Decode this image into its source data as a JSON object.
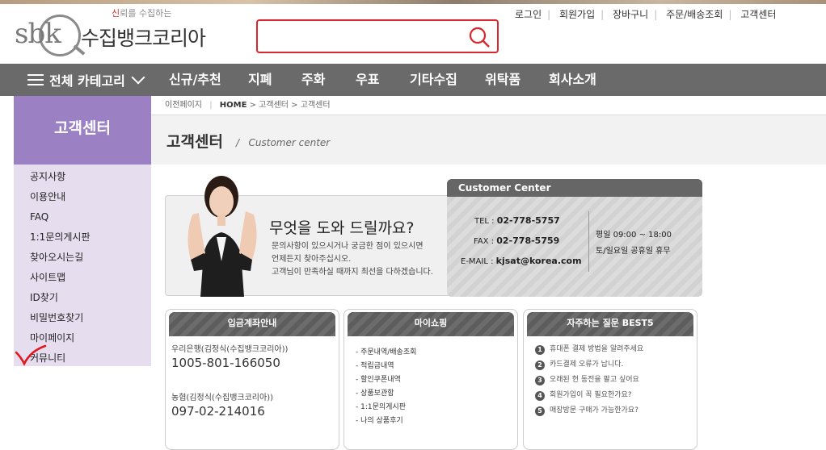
{
  "logo": {
    "sbk": "sbk",
    "slogan_red": "신",
    "slogan_rest": "뢰를 수집하는",
    "name": "수집뱅크코리아"
  },
  "search": {
    "placeholder": ""
  },
  "toplinks": [
    "로그인",
    "회원가입",
    "장바구니",
    "주문/배송조회",
    "고객센터"
  ],
  "nav": {
    "all_label": "전체 카테고리",
    "items": [
      "신규/추천",
      "지폐",
      "주화",
      "우표",
      "기타수집",
      "위탁품",
      "회사소개"
    ]
  },
  "sidebar": {
    "title": "고객센터",
    "items": [
      "공지사항",
      "이용안내",
      "FAQ",
      "1:1문의게시판",
      "찾아오시는길",
      "사이트맵",
      "ID찾기",
      "비밀번호찾기",
      "마이페이지",
      "커뮤니티"
    ]
  },
  "breadcrumb": {
    "prev": "이전페이지",
    "home": "HOME",
    "sep": ">",
    "level1": "고객센터",
    "level2": "고객센터"
  },
  "title": {
    "main": "고객센터",
    "slash": "/",
    "sub": "Customer center"
  },
  "banner": {
    "heading": "무엇을 도와 드릴까요?",
    "line1": "문의사항이 있으시거나 궁금한 점이 있으시면",
    "line2": "언제든지 찾아주십시오.",
    "line3": "고객님이 만족하실 때까지 최선을 다하겠습니다."
  },
  "customer_center": {
    "title": "Customer Center",
    "tel_label": "TEL :",
    "tel": "02-778-5757",
    "fax_label": "FAX :",
    "fax": "02-778-5759",
    "email_label": "E-MAIL :",
    "email": "kjsat@korea.com",
    "hours": "평일 09:00 ~ 18:00",
    "closed": "토/일요일 공휴일 휴무"
  },
  "deposit": {
    "title": "입금계좌안내",
    "bank1_label": "우리은행(김정식(수집뱅크코리아))",
    "bank1_number": "1005-801-166050",
    "bank2_label": "농협(김정식(수집뱅크코리아))",
    "bank2_number": "097-02-214016"
  },
  "myshop": {
    "title": "마이쇼핑",
    "items": [
      "- 주문내역/배송조회",
      "- 적립금내역",
      "- 할인쿠폰내역",
      "- 상품보관함",
      "- 1:1문의게시판",
      "- 나의 상품후기"
    ]
  },
  "faq": {
    "title": "자주하는 질문 BEST5",
    "items": [
      "휴대폰 결제 방법을 알려주세요",
      "카드결제 오류가 납니다.",
      "오래된 헌 동전을 팔고 싶어요",
      "회원가입이 꼭 필요한가요?",
      "매장방문 구매가 가능한가요?"
    ]
  },
  "colors": {
    "accent_red": "#d9262c",
    "nav_gray": "#6a6a6a",
    "sidebar_purple": "#9b80c3",
    "sidebar_bg": "#e6ddef"
  },
  "icons": {
    "search": "search-icon",
    "menu": "hamburger-icon",
    "dropdown": "chevron-down-icon",
    "check": "checkmark-icon"
  }
}
